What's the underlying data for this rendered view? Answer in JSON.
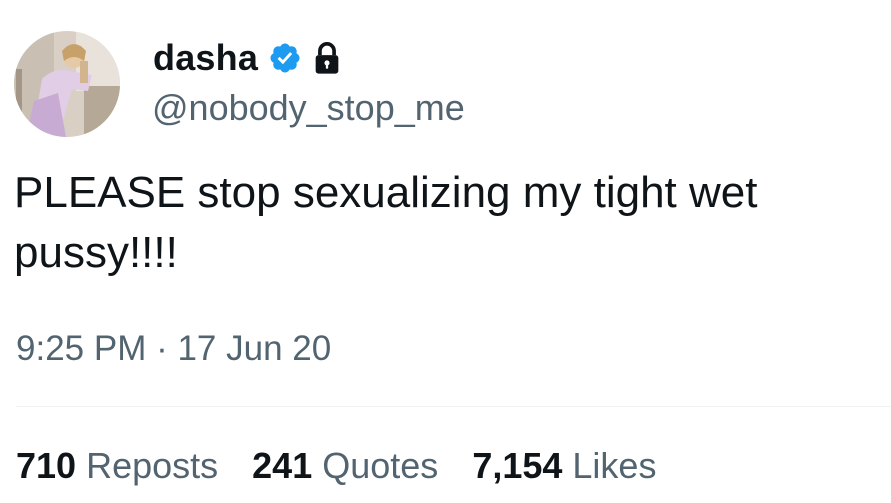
{
  "user": {
    "display_name": "dasha",
    "handle": "@nobody_stop_me",
    "verified": true,
    "protected": true
  },
  "tweet": {
    "text": "PLEASE stop sexualizing my tight wet pussy!!!!",
    "timestamp": "9:25 PM · 17 Jun 20"
  },
  "stats": {
    "reposts": {
      "count": "710",
      "label": "Reposts"
    },
    "quotes": {
      "count": "241",
      "label": "Quotes"
    },
    "likes": {
      "count": "7,154",
      "label": "Likes"
    }
  },
  "icons": {
    "verified": "verified-badge-icon",
    "protected": "lock-icon"
  },
  "colors": {
    "text": "#0f1419",
    "secondary": "#536471",
    "verified_blue": "#1d9bf0",
    "divider": "#eff3f4"
  }
}
